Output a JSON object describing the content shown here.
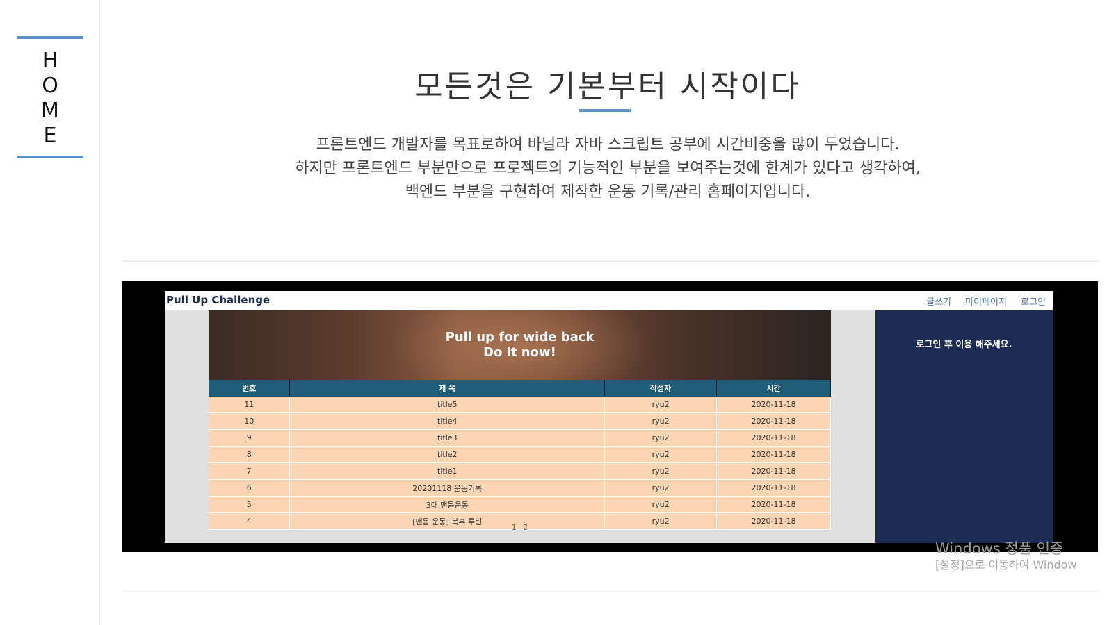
{
  "sidebar": {
    "label_letters": [
      "H",
      "O",
      "M",
      "E"
    ]
  },
  "main": {
    "title": "모든것은 기본부터 시작이다",
    "description": [
      "프론트엔드 개발자를 목표로하여 바닐라 자바 스크립트 공부에 시간비중을 많이 두었습니다.",
      "하지만 프론트엔드 부분만으로 프로젝트의 기능적인 부분을 보여주는것에 한계가 있다고 생각하여,",
      "백엔드 부분을 구현하여 제작한 운동 기록/관리 홈페이지입니다."
    ]
  },
  "preview": {
    "brand": "Pull Up Challenge",
    "nav": [
      "글쓰기",
      "마이페이지",
      "로그인"
    ],
    "banner_lines": [
      "Pull up for wide back",
      "Do it now!"
    ],
    "table": {
      "headers": [
        "번호",
        "제 목",
        "작성자",
        "시간"
      ],
      "rows": [
        [
          "11",
          "title5",
          "ryu2",
          "2020-11-18"
        ],
        [
          "10",
          "title4",
          "ryu2",
          "2020-11-18"
        ],
        [
          "9",
          "title3",
          "ryu2",
          "2020-11-18"
        ],
        [
          "8",
          "title2",
          "ryu2",
          "2020-11-18"
        ],
        [
          "7",
          "title1",
          "ryu2",
          "2020-11-18"
        ],
        [
          "6",
          "20201118 운동기록",
          "ryu2",
          "2020-11-18"
        ],
        [
          "5",
          "3대 맨몸운동",
          "ryu2",
          "2020-11-18"
        ],
        [
          "4",
          "[맨몸 운동] 복부 루틴",
          "ryu2",
          "2020-11-18"
        ]
      ]
    },
    "pages": [
      "1",
      "2"
    ],
    "panel_message": "로그인 후 이용 해주세요."
  },
  "watermark": {
    "line1": "Windows 정품 인증",
    "line2": "[설정]으로 이동하여 Window"
  },
  "colors": {
    "accent": "#5b93d1",
    "panel": "#1b2b54",
    "table_header": "#1f5d79",
    "table_row": "#fcd6b4"
  }
}
